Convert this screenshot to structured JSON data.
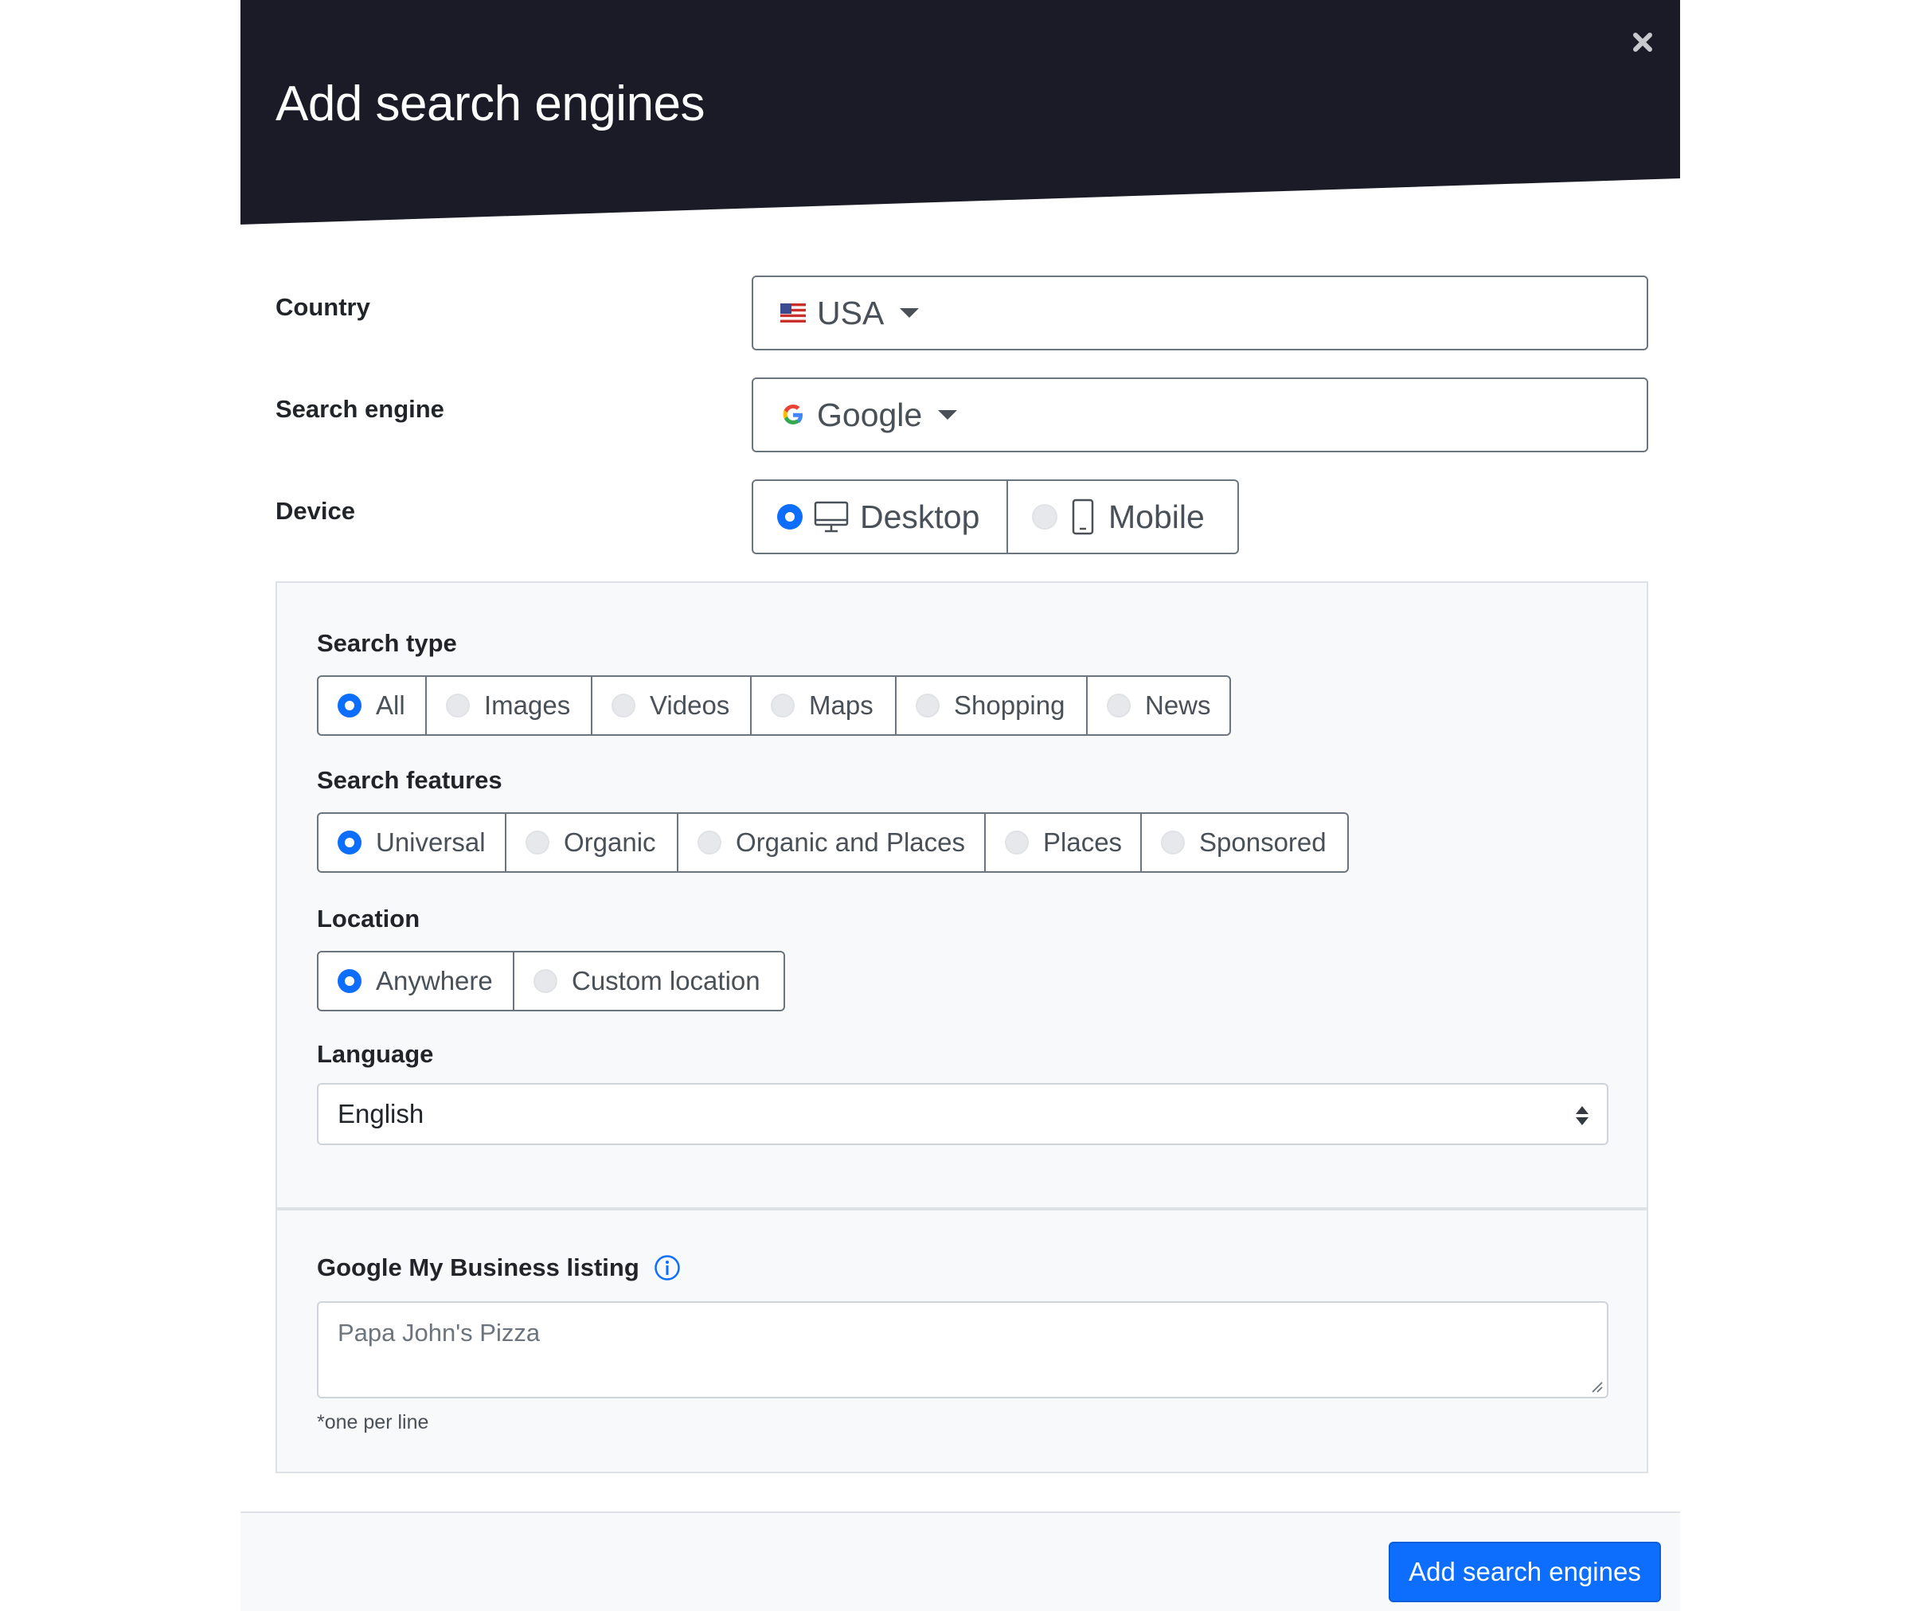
{
  "modal": {
    "title": "Add search engines",
    "close_label": "×"
  },
  "form": {
    "country": {
      "label": "Country",
      "value": "USA",
      "icon": "us-flag-icon"
    },
    "search_engine": {
      "label": "Search engine",
      "value": "Google",
      "icon": "google-icon"
    },
    "device": {
      "label": "Device",
      "options": [
        {
          "label": "Desktop",
          "icon": "desktop-icon",
          "selected": true
        },
        {
          "label": "Mobile",
          "icon": "mobile-icon",
          "selected": false
        }
      ]
    }
  },
  "panel": {
    "search_type": {
      "label": "Search type",
      "options": [
        {
          "label": "All",
          "selected": true
        },
        {
          "label": "Images",
          "selected": false
        },
        {
          "label": "Videos",
          "selected": false
        },
        {
          "label": "Maps",
          "selected": false
        },
        {
          "label": "Shopping",
          "selected": false
        },
        {
          "label": "News",
          "selected": false
        }
      ]
    },
    "search_features": {
      "label": "Search features",
      "options": [
        {
          "label": "Universal",
          "selected": true
        },
        {
          "label": "Organic",
          "selected": false
        },
        {
          "label": "Organic and Places",
          "selected": false
        },
        {
          "label": "Places",
          "selected": false
        },
        {
          "label": "Sponsored",
          "selected": false
        }
      ]
    },
    "location": {
      "label": "Location",
      "options": [
        {
          "label": "Anywhere",
          "selected": true
        },
        {
          "label": "Custom location",
          "selected": false
        }
      ]
    },
    "language": {
      "label": "Language",
      "value": "English"
    },
    "gmb": {
      "label": "Google My Business listing",
      "placeholder": "Papa John's Pizza",
      "hint": "*one per line"
    }
  },
  "footer": {
    "submit_label": "Add search engines"
  },
  "colors": {
    "header_bg": "#1a1b26",
    "accent": "#0d6efd",
    "panel_bg": "#f8f9fa",
    "border": "#6c757d"
  }
}
